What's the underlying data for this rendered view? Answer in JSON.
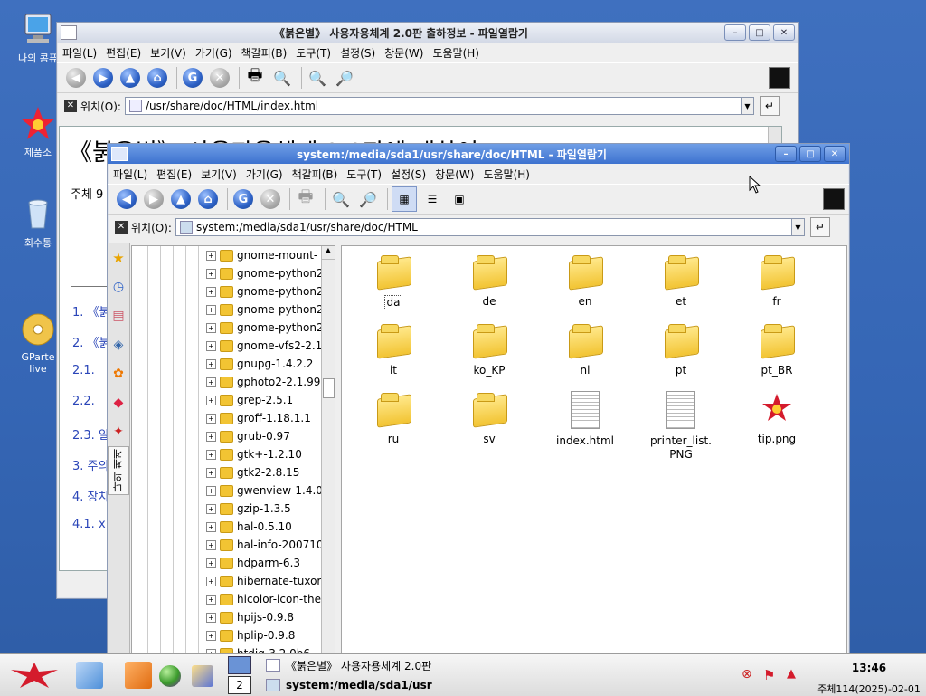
{
  "desktop_icons": [
    {
      "label": "나의 콤퓨",
      "icon": "computer-icon"
    },
    {
      "label": "제품소",
      "icon": "star-logo-icon"
    },
    {
      "label": "회수통",
      "icon": "trash-icon"
    },
    {
      "label": "GParte\nlive",
      "icon": "cd-icon"
    }
  ],
  "back_window": {
    "title": "《붉은별》 사용자용체계 2.0판 출하정보 - 파일열람기",
    "menu": [
      "파일(L)",
      "편집(E)",
      "보기(V)",
      "가기(G)",
      "책갈피(B)",
      "도구(T)",
      "설정(S)",
      "창문(W)",
      "도움말(H)"
    ],
    "location_label": "위치(O):",
    "location_value": "/usr/share/doc/HTML/index.html",
    "doc_heading": "《붉은별》 사용자용체계 2.0판에 대하여",
    "doc_sub": "주체 9",
    "doc_links": [
      "1. 《붉",
      "2. 《붉",
      "2.1.",
      "2.2.",
      "2.3. 알",
      "3. 주의",
      "4. 장치",
      "4.1. x"
    ]
  },
  "front_window": {
    "title": "system:/media/sda1/usr/share/doc/HTML - 파일열람기",
    "menu": [
      "파일(L)",
      "편집(E)",
      "보기(V)",
      "가기(G)",
      "책갈피(B)",
      "도구(T)",
      "설정(S)",
      "창문(W)",
      "도움말(H)"
    ],
    "location_label": "위치(O):",
    "location_value": "system:/media/sda1/usr/share/doc/HTML",
    "side_tab_label": "나의 체계",
    "tree_items": [
      "gnome-mount-",
      "gnome-python2",
      "gnome-python2",
      "gnome-python2",
      "gnome-python2",
      "gnome-vfs2-2.1",
      "gnupg-1.4.2.2",
      "gphoto2-2.1.99",
      "grep-2.5.1",
      "groff-1.18.1.1",
      "grub-0.97",
      "gtk+-1.2.10",
      "gtk2-2.8.15",
      "gwenview-1.4.0",
      "gzip-1.3.5",
      "hal-0.5.10",
      "hal-info-200710",
      "hdparm-6.3",
      "hibernate-tuxor",
      "hicolor-icon-the",
      "hpijs-0.9.8",
      "hplip-0.9.8",
      "htdig-3.2.0b6"
    ],
    "files": [
      {
        "name": "da",
        "type": "folder"
      },
      {
        "name": "de",
        "type": "folder"
      },
      {
        "name": "en",
        "type": "folder"
      },
      {
        "name": "et",
        "type": "folder"
      },
      {
        "name": "fr",
        "type": "folder"
      },
      {
        "name": "it",
        "type": "folder"
      },
      {
        "name": "ko_KP",
        "type": "folder"
      },
      {
        "name": "nl",
        "type": "folder"
      },
      {
        "name": "pt",
        "type": "folder"
      },
      {
        "name": "pt_BR",
        "type": "folder"
      },
      {
        "name": "ru",
        "type": "folder"
      },
      {
        "name": "sv",
        "type": "folder"
      },
      {
        "name": "index.html",
        "type": "html"
      },
      {
        "name": "printer_list.\nPNG",
        "type": "image"
      },
      {
        "name": "tip.png",
        "type": "png-star"
      }
    ]
  },
  "taskbar": {
    "desktop_number": "2",
    "tasks": [
      "《붉은별》 사용자용체계 2.0판",
      "system:/media/sda1/usr"
    ],
    "clock_time": "13:46",
    "clock_date": "주체114(2025)-02-01"
  }
}
